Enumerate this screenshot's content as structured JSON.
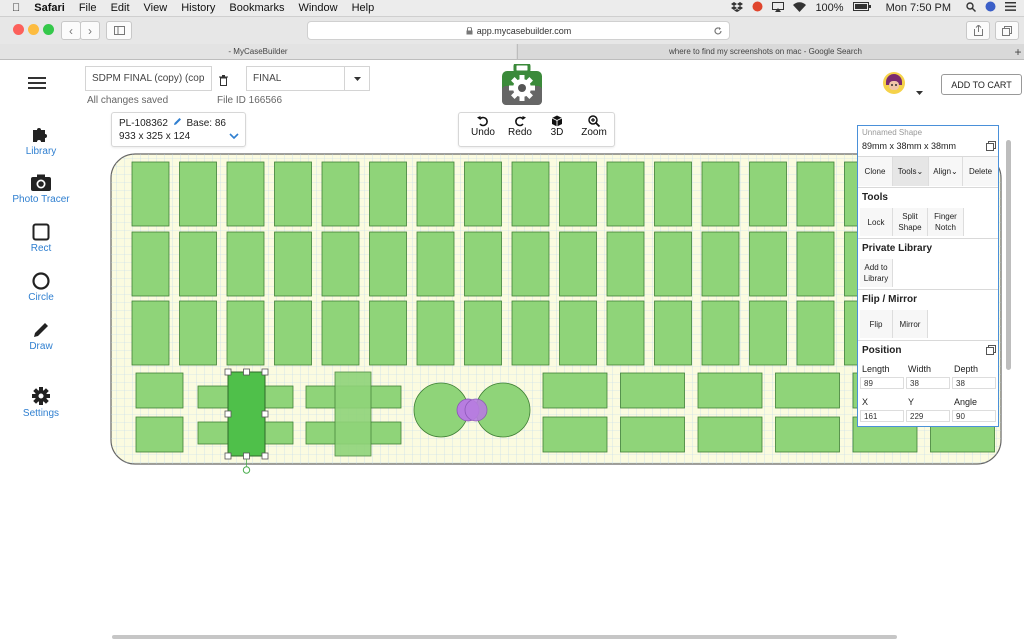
{
  "menubar": {
    "apple": "",
    "items": [
      "Safari",
      "File",
      "Edit",
      "View",
      "History",
      "Bookmarks",
      "Window",
      "Help"
    ],
    "battery": "100%",
    "clock": "Mon 7:50 PM"
  },
  "browser": {
    "url": "app.mycasebuilder.com",
    "tabs": [
      {
        "title": "- MyCaseBuilder"
      },
      {
        "title": "where to find my screenshots on mac - Google Search"
      }
    ],
    "new_tab": "+"
  },
  "header": {
    "design_name": "SDPM FINAL (copy) (cop",
    "version_value": "FINAL",
    "save_status": "All changes saved",
    "file_id": "File ID 166566",
    "cart_label": "ADD TO CART"
  },
  "sidebar": {
    "items": [
      {
        "label": "Library",
        "icon": "puzzle-icon"
      },
      {
        "label": "Photo Tracer",
        "icon": "camera-icon"
      },
      {
        "label": "Rect",
        "icon": "square-icon"
      },
      {
        "label": "Circle",
        "icon": "circle-icon"
      },
      {
        "label": "Draw",
        "icon": "pencil-icon"
      },
      {
        "label": "Settings",
        "icon": "gear-icon"
      }
    ]
  },
  "case_info": {
    "id": "PL-108362",
    "base": "Base: 86",
    "dims": "933 x 325 x 124"
  },
  "toolbar": {
    "undo": "Undo",
    "redo": "Redo",
    "view3d": "3D",
    "zoom": "Zoom"
  },
  "panel": {
    "shape_name": "Unnamed Shape",
    "size": "89mm x 38mm x 38mm",
    "actions": {
      "clone": "Clone",
      "tools": "Tools",
      "align": "Align",
      "delete": "Delete"
    },
    "tools_title": "Tools",
    "tools": {
      "lock": "Lock",
      "split": "Split Shape",
      "finger": "Finger Notch"
    },
    "private_title": "Private Library",
    "add_library": "Add to Library",
    "flip_title": "Flip / Mirror",
    "flip": "Flip",
    "mirror": "Mirror",
    "position_title": "Position",
    "length_label": "Length",
    "width_label": "Width",
    "depth_label": "Depth",
    "length": "89",
    "width": "38",
    "depth": "38",
    "x_label": "X",
    "y_label": "Y",
    "angle_label": "Angle",
    "x": "161",
    "y": "229",
    "angle": "90"
  },
  "colors": {
    "shape_fill": "#8fd479",
    "shape_stroke": "#3f7f36",
    "selected_fill": "#4fc04a",
    "grid_bg": "#fbfbe0",
    "accent": "#2f7fd0",
    "purple": "#b77de0"
  }
}
